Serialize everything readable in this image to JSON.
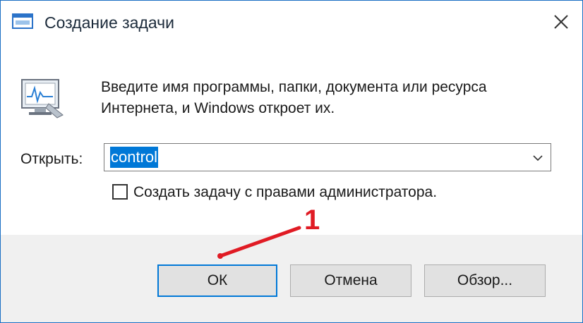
{
  "window": {
    "title": "Создание задачи",
    "icons": {
      "title": "run-dialog-icon",
      "close": "close-icon",
      "app": "task-monitor-icon"
    }
  },
  "dialog": {
    "instruction": "Введите имя программы, папки, документа или ресурса Интернета, и Windows откроет их.",
    "open_label": "Открыть:",
    "open_value": "control",
    "admin_checkbox_label": "Создать задачу с правами администратора.",
    "admin_checked": false
  },
  "buttons": {
    "ok": "ОК",
    "cancel": "Отмена",
    "browse": "Обзор..."
  },
  "annotation": {
    "number": "1",
    "color": "#e01b24"
  },
  "colors": {
    "accent": "#0078d7",
    "border": "#1a6fc4",
    "footer_bg": "#f0f0f0"
  }
}
